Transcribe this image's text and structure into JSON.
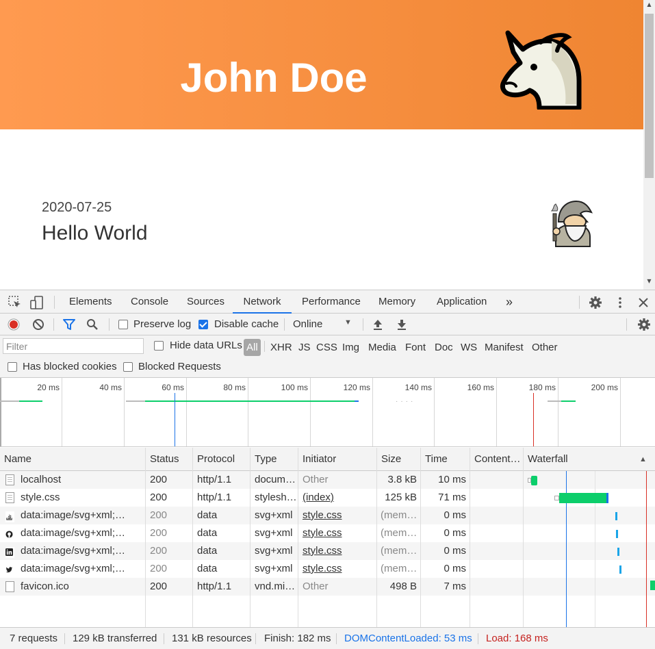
{
  "page": {
    "hero_title": "John Doe",
    "post_date": "2020-07-25",
    "post_title": "Hello World",
    "hero_color": "#f28a3c"
  },
  "devtools": {
    "tabs": [
      "Elements",
      "Console",
      "Sources",
      "Network",
      "Performance",
      "Memory",
      "Application"
    ],
    "active_tab": "Network",
    "more_tabs": "»",
    "toolbar": {
      "preserve_log": "Preserve log",
      "preserve_log_checked": false,
      "disable_cache": "Disable cache",
      "disable_cache_checked": true,
      "throttling": "Online"
    },
    "filter": {
      "placeholder": "Filter",
      "hide_data_urls": "Hide data URLs",
      "types": [
        "All",
        "XHR",
        "JS",
        "CSS",
        "Img",
        "Media",
        "Font",
        "Doc",
        "WS",
        "Manifest",
        "Other"
      ],
      "selected_type": "All",
      "has_blocked_cookies": "Has blocked cookies",
      "blocked_requests": "Blocked Requests"
    },
    "overview_ticks": [
      "20 ms",
      "40 ms",
      "60 ms",
      "80 ms",
      "100 ms",
      "120 ms",
      "140 ms",
      "160 ms",
      "180 ms",
      "200 ms"
    ],
    "columns": [
      "Name",
      "Status",
      "Protocol",
      "Type",
      "Initiator",
      "Size",
      "Time",
      "Content…",
      "Waterfall"
    ],
    "rows": [
      {
        "name": "localhost",
        "status": "200",
        "protocol": "http/1.1",
        "type": "docum…",
        "initiator": "Other",
        "size": "3.8 kB",
        "time": "10 ms",
        "icon": "document-icon"
      },
      {
        "name": "style.css",
        "status": "200",
        "protocol": "http/1.1",
        "type": "stylesh…",
        "initiator": "(index)",
        "size": "125 kB",
        "time": "71 ms",
        "icon": "stylesheet-icon"
      },
      {
        "name": "data:image/svg+xml;…",
        "status": "200",
        "protocol": "data",
        "type": "svg+xml",
        "initiator": "style.css",
        "size": "(mem…",
        "time": "0 ms",
        "icon": "stackoverflow-icon"
      },
      {
        "name": "data:image/svg+xml;…",
        "status": "200",
        "protocol": "data",
        "type": "svg+xml",
        "initiator": "style.css",
        "size": "(mem…",
        "time": "0 ms",
        "icon": "github-icon"
      },
      {
        "name": "data:image/svg+xml;…",
        "status": "200",
        "protocol": "data",
        "type": "svg+xml",
        "initiator": "style.css",
        "size": "(mem…",
        "time": "0 ms",
        "icon": "linkedin-icon"
      },
      {
        "name": "data:image/svg+xml;…",
        "status": "200",
        "protocol": "data",
        "type": "svg+xml",
        "initiator": "style.css",
        "size": "(mem…",
        "time": "0 ms",
        "icon": "twitter-icon"
      },
      {
        "name": "favicon.ico",
        "status": "200",
        "protocol": "http/1.1",
        "type": "vnd.mi…",
        "initiator": "Other",
        "size": "498 B",
        "time": "7 ms",
        "icon": "blank-file-icon"
      }
    ],
    "status_bar": {
      "requests": "7 requests",
      "transferred": "129 kB transferred",
      "resources": "131 kB resources",
      "finish": "Finish: 182 ms",
      "dom_content_loaded": "DOMContentLoaded: 53 ms",
      "load": "Load: 168 ms"
    },
    "colors": {
      "record": "#d93025",
      "accent": "#1a73e8",
      "waterfall_green": "#0cce6b",
      "dcl_blue": "#1a73e8",
      "load_red": "#d93025"
    }
  }
}
